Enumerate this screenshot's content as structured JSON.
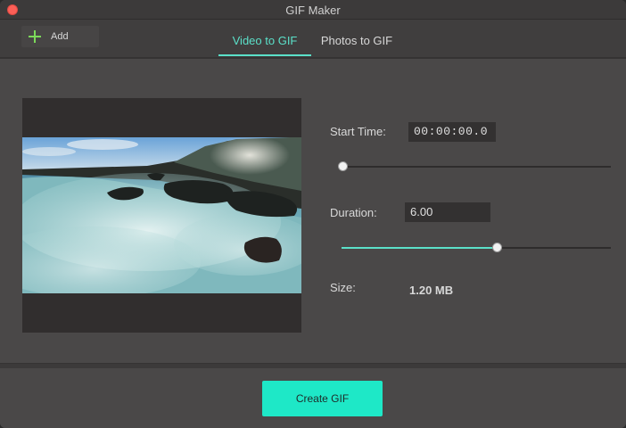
{
  "window": {
    "title": "GIF Maker"
  },
  "toolbar": {
    "add_label": "Add",
    "tabs": [
      {
        "label": "Video to GIF",
        "active": true
      },
      {
        "label": "Photos to GIF",
        "active": false
      }
    ]
  },
  "settings": {
    "start_time": {
      "label": "Start Time:",
      "value": "00:00:00.0",
      "slider_fraction": 0.0
    },
    "duration": {
      "label": "Duration:",
      "value": "6.00",
      "slider_fraction": 0.58
    },
    "size": {
      "label": "Size:",
      "value": "1.20 MB"
    }
  },
  "footer": {
    "create_label": "Create GIF"
  },
  "colors": {
    "accent": "#5be0c9",
    "create_button": "#1ee8c7",
    "close": "#fc5f57",
    "add_icon": "#7cd95a"
  }
}
